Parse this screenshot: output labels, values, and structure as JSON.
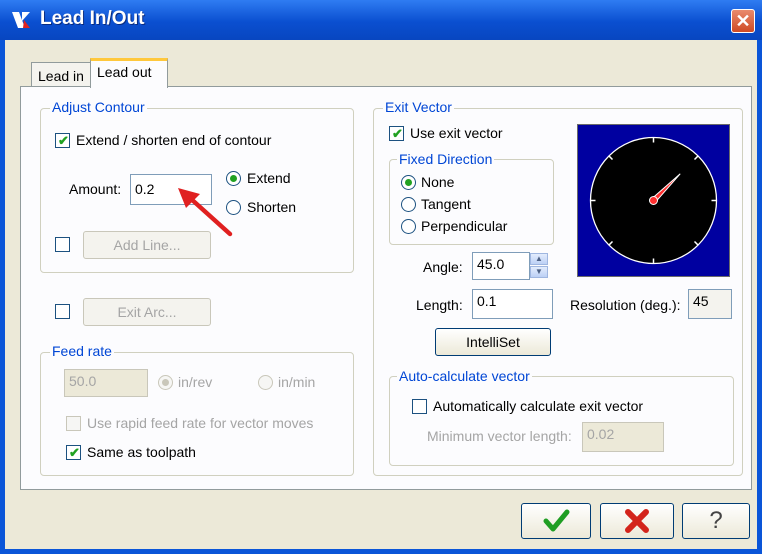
{
  "window": {
    "title": "Lead In/Out",
    "close_glyph": "✕"
  },
  "tabs": [
    {
      "label": "Lead in"
    },
    {
      "label": "Lead out"
    }
  ],
  "adjust_contour": {
    "legend": "Adjust Contour",
    "extend_shorten_label": "Extend / shorten end of contour",
    "amount_label": "Amount:",
    "amount_value": "0.2",
    "extend_label": "Extend",
    "shorten_label": "Shorten",
    "add_line_label": "Add Line..."
  },
  "exit_arc": {
    "label": "Exit Arc..."
  },
  "feed_rate": {
    "legend": "Feed rate",
    "value": "50.0",
    "in_rev_label": "in/rev",
    "in_min_label": "in/min",
    "rapid_label": "Use rapid feed rate for vector moves",
    "same_as_toolpath_label": "Same as toolpath"
  },
  "exit_vector": {
    "legend": "Exit Vector",
    "use_label": "Use exit vector",
    "fixed_direction_legend": "Fixed Direction",
    "none_label": "None",
    "tangent_label": "Tangent",
    "perpendicular_label": "Perpendicular",
    "angle_label": "Angle:",
    "angle_value": "45.0",
    "length_label": "Length:",
    "length_value": "0.1",
    "resolution_label": "Resolution (deg.):",
    "resolution_value": "45",
    "intelliset_label": "IntelliSet",
    "compass_angle_deg": 45
  },
  "auto_calc": {
    "legend": "Auto-calculate vector",
    "auto_label": "Automatically calculate exit vector",
    "min_length_label": "Minimum vector length:",
    "min_length_value": "0.02"
  },
  "footer": {
    "ok_icon": "checkmark-icon",
    "cancel_icon": "red-x-icon",
    "help_glyph": "?"
  },
  "colors": {
    "titlebar": "#0a55d8",
    "legend": "#0046d5",
    "check": "#21a121",
    "annotation_arrow": "#e02020"
  }
}
